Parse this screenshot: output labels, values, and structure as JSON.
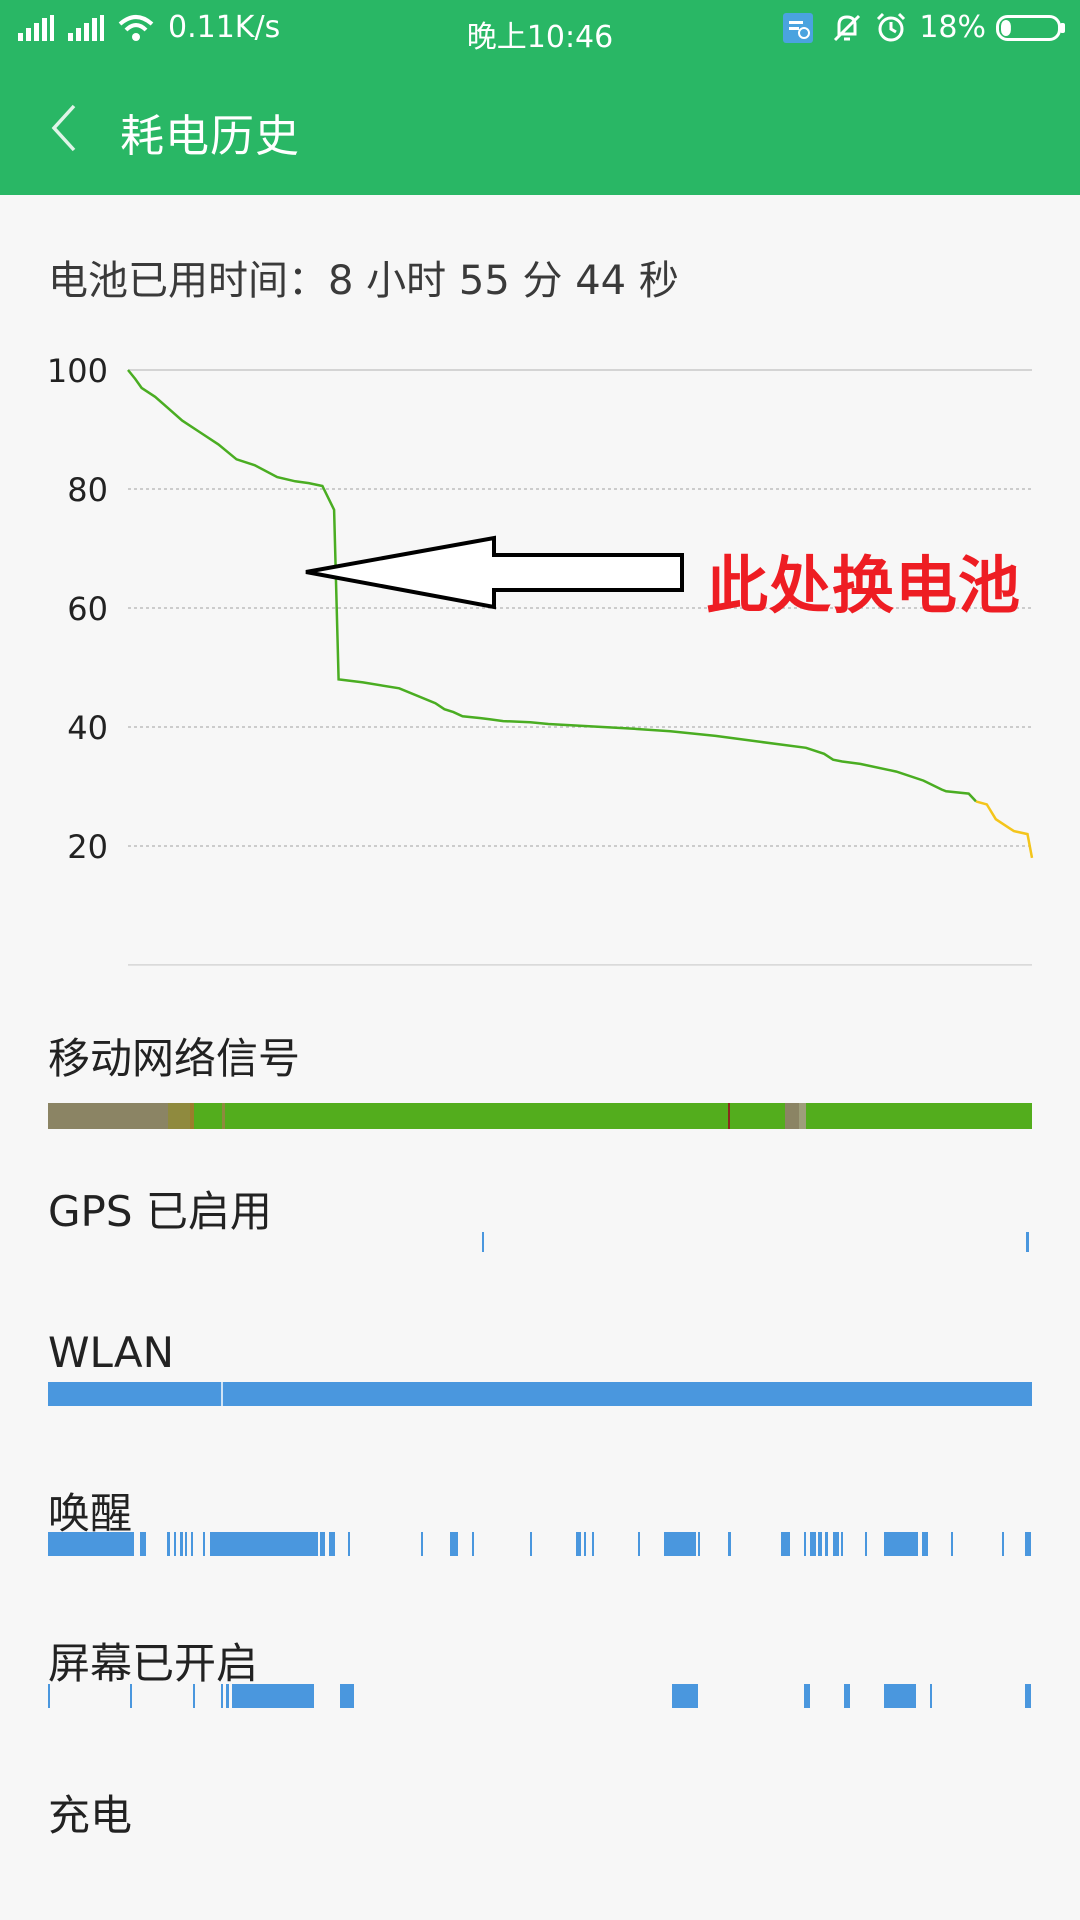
{
  "status_bar": {
    "network_speed": "0.11K/s",
    "time": "晚上10:46",
    "battery_percent": "18%",
    "battery_level": 0.18,
    "icons": [
      "signal-icon",
      "signal-icon",
      "wifi-icon",
      "notification-icon",
      "mute-icon",
      "alarm-icon",
      "battery-icon"
    ]
  },
  "header": {
    "title": "耗电历史",
    "back_icon": "chevron-left-icon"
  },
  "battery_usage": {
    "label": "电池已用时间：",
    "value": "8 小时 55 分 44 秒"
  },
  "annotation": {
    "text": "此处换电池",
    "arrow_icon": "left-arrow-icon"
  },
  "colors": {
    "header": "#29b765",
    "line_green": "#4aad22",
    "line_yellow": "#f4c51b",
    "signal_green": "#53ad1d",
    "signal_grey": "#8b8464",
    "blue": "#4a97de",
    "annotation_red": "#ee1d23"
  },
  "chart_data": {
    "type": "line",
    "ylim": [
      0,
      100
    ],
    "yticks": [
      "100",
      "80",
      "60",
      "40",
      "20"
    ],
    "grid": true,
    "xlim": [
      0,
      100
    ],
    "series": [
      {
        "color": "green",
        "x": [
          0,
          0.8,
          1.5,
          3,
          4.5,
          6,
          8,
          10,
          12,
          14,
          16.5,
          18.5,
          20,
          21.5,
          22.8,
          23.3,
          26,
          30,
          34,
          35,
          36,
          37,
          39,
          40,
          41.5,
          44.5,
          46.5,
          50,
          55,
          60,
          65,
          70,
          75,
          77,
          78,
          79,
          81,
          85,
          88,
          90,
          90.5,
          93,
          93.8
        ],
        "y": [
          100,
          98.5,
          97,
          95.5,
          93.5,
          91.5,
          89.5,
          87.5,
          85,
          84,
          82,
          81.3,
          81,
          80.5,
          76.5,
          48,
          47.5,
          46.5,
          44,
          43,
          42.5,
          41.8,
          41.5,
          41.3,
          41,
          40.8,
          40.5,
          40.2,
          39.8,
          39.3,
          38.5,
          37.5,
          36.5,
          35.5,
          34.5,
          34.2,
          33.8,
          32.5,
          31,
          29.5,
          29.2,
          28.8,
          27.5
        ]
      },
      {
        "color": "yellow",
        "x": [
          93.8,
          95,
          96,
          97.5,
          98,
          99.5,
          100
        ],
        "y": [
          27.5,
          27,
          24.5,
          23,
          22.5,
          22,
          18
        ]
      }
    ]
  },
  "sections": {
    "mobile_signal": "移动网络信号",
    "gps": "GPS 已启用",
    "wlan": "WLAN",
    "wakeup": "唤醒",
    "screen_on": "屏幕已开启",
    "charging": "充电"
  }
}
